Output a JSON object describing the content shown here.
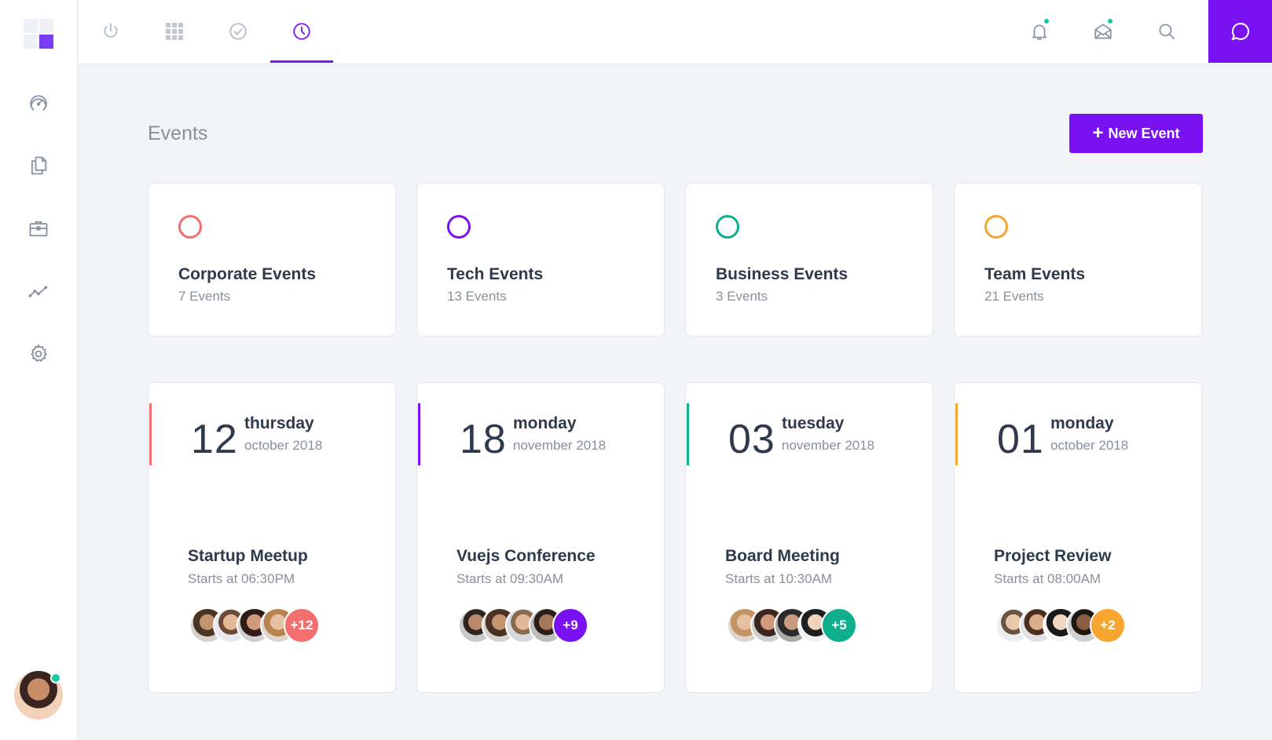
{
  "colors": {
    "accent": "#7a11f2",
    "coral": "#f26f6f",
    "purple": "#7a11f2",
    "teal": "#0fae8c",
    "orange": "#f5a530"
  },
  "sidebar": {
    "icons": [
      "dashboard-gauge-icon",
      "documents-icon",
      "briefcase-icon",
      "analytics-trend-icon",
      "settings-gear-icon"
    ]
  },
  "topbar": {
    "tabs": [
      "power-icon",
      "apps-grid-icon",
      "check-circle-icon",
      "clock-icon"
    ],
    "active_tab": "clock-icon"
  },
  "page": {
    "title": "Events",
    "new_event_label": "New Event"
  },
  "categories": [
    {
      "name": "Corporate Events",
      "count": "7 Events",
      "color": "#f26f6f"
    },
    {
      "name": "Tech Events",
      "count": "13 Events",
      "color": "#7a11f2"
    },
    {
      "name": "Business Events",
      "count": "3 Events",
      "color": "#0fae8c"
    },
    {
      "name": "Team Events",
      "count": "21 Events",
      "color": "#f5a530"
    }
  ],
  "events": [
    {
      "day": "12",
      "weekday": "thursday",
      "monthyear": "october 2018",
      "title": "Startup Meetup",
      "time": "Starts at 06:30PM",
      "more": "+12",
      "color": "#f26f6f"
    },
    {
      "day": "18",
      "weekday": "monday",
      "monthyear": "november 2018",
      "title": "Vuejs Conference",
      "time": "Starts at 09:30AM",
      "more": "+9",
      "color": "#7a11f2"
    },
    {
      "day": "03",
      "weekday": "tuesday",
      "monthyear": "november 2018",
      "title": "Board Meeting",
      "time": "Starts at 10:30AM",
      "more": "+5",
      "color": "#0fae8c"
    },
    {
      "day": "01",
      "weekday": "monday",
      "monthyear": "october 2018",
      "title": "Project Review",
      "time": "Starts at 08:00AM",
      "more": "+2",
      "color": "#f5a530"
    }
  ]
}
